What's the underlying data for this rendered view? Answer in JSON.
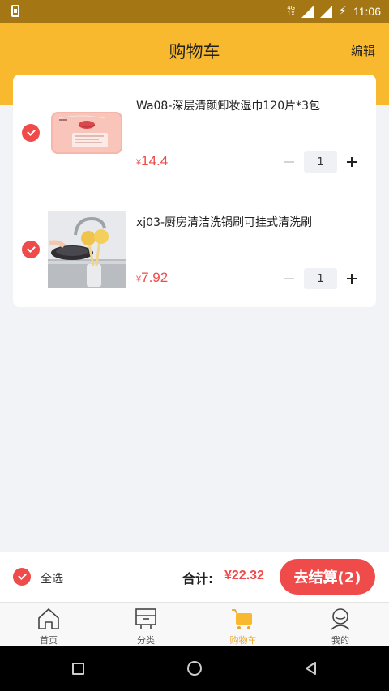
{
  "status_bar": {
    "time": "11:06",
    "network_top": "4G",
    "network_bottom": "1X",
    "icons": [
      "sim-icon",
      "signal-icon",
      "battery-charging-icon"
    ]
  },
  "header": {
    "title": "购物车",
    "edit_label": "编辑"
  },
  "cart": {
    "items": [
      {
        "title": "Wa08-深层清颜卸妆湿巾120片*3包",
        "currency": "¥",
        "price": "14.4",
        "quantity": "1",
        "checked": true,
        "image": "makeup-wipes-pack"
      },
      {
        "title": "xj03-厨房清洁洗锅刷可挂式清洗刷",
        "currency": "¥",
        "price": "7.92",
        "quantity": "1",
        "checked": true,
        "image": "kitchen-pot-brush"
      }
    ]
  },
  "checkout": {
    "select_all_label": "全选",
    "total_label": "合计:",
    "total_value": "¥22.32",
    "button_label": "去结算(2)"
  },
  "tabbar": {
    "tabs": [
      {
        "label": "首页",
        "icon": "home-icon"
      },
      {
        "label": "分类",
        "icon": "category-icon"
      },
      {
        "label": "购物车",
        "icon": "cart-icon",
        "active": true
      },
      {
        "label": "我的",
        "icon": "profile-icon"
      }
    ]
  },
  "colors": {
    "brand": "#f8b92e",
    "accent": "#ef4b4b",
    "active_tab": "#e9a72a"
  }
}
